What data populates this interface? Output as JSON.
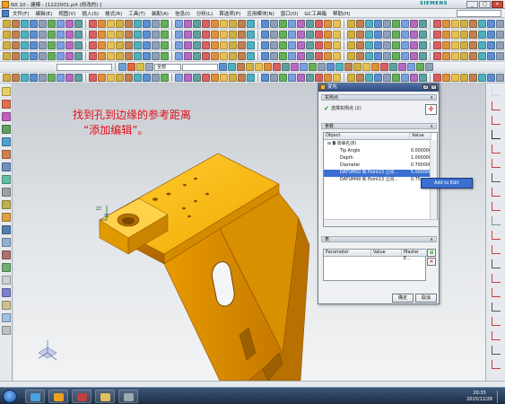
{
  "window": {
    "title": "NX 10 - 建模 - [1222001.prt (修改的) ]",
    "brand": "SIEMENS",
    "minimize": "_",
    "maximize": "□",
    "close": "✕"
  },
  "menu": [
    "文件(F)",
    "编辑(E)",
    "视图(V)",
    "插入(S)",
    "格式(R)",
    "工具(T)",
    "装配(A)",
    "信息(I)",
    "分析(L)",
    "首选项(P)",
    "应用模块(N)",
    "窗口(O)",
    "GC工具箱",
    "帮助(H)"
  ],
  "toolbar": {
    "filter_value": "全部"
  },
  "annotation": {
    "line1": "找到孔到边缘的参考距离",
    "line2": "“添加编辑”。"
  },
  "viewport": {
    "axis_zc": "ZC",
    "axis_yc": "YC"
  },
  "dialog": {
    "title": "变化",
    "group_ref": "实例点",
    "ref_label": "选择实例点 (2)",
    "group_params": "参数",
    "col_object": "Object",
    "col_value": "Value",
    "rows": [
      {
        "name": "简单孔(8)",
        "value": ""
      },
      {
        "name": "Tip Angle",
        "value": "0.000000"
      },
      {
        "name": "Depth",
        "value": "1.000000"
      },
      {
        "name": "Diameter",
        "value": "0.700000"
      },
      {
        "name": "DATUM50 和 Point13 之间...",
        "value": "5.000000"
      },
      {
        "name": "DATUM49 和 Point13 之间...",
        "value": "0.75..."
      }
    ],
    "group_expr": "表",
    "col_parameter": "Parameter",
    "col_value2": "Value",
    "col_master": "Master E...",
    "ok": "确定",
    "cancel": "取消"
  },
  "context_menu": {
    "item": "Add to Edit"
  },
  "taskbar": {
    "time": "20:35",
    "date": "2015/12/28"
  }
}
